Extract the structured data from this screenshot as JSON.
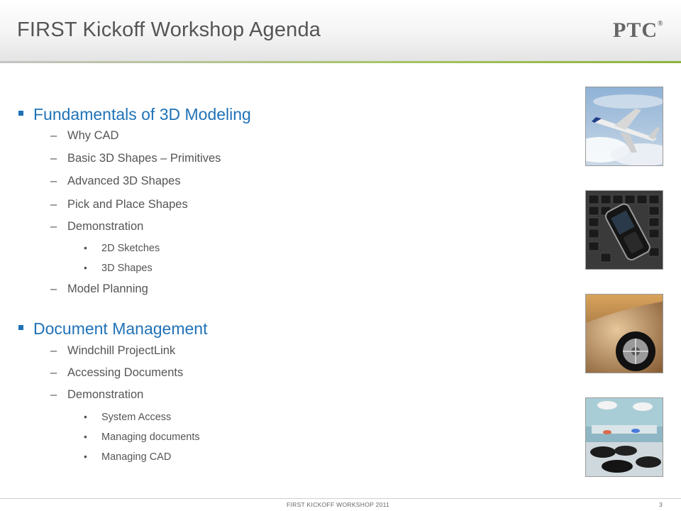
{
  "slide": {
    "title": "FIRST Kickoff Workshop Agenda",
    "logo": "PTC",
    "logo_mark": "®",
    "footer": "FIRST KICKOFF WORKSHOP 2011",
    "page_number": "3"
  },
  "sections": [
    {
      "heading": "Fundamentals of 3D Modeling",
      "items": [
        "Why CAD",
        "Basic 3D Shapes – Primitives",
        "Advanced 3D Shapes",
        "Pick and Place Shapes",
        "Demonstration"
      ],
      "demo_subitems": [
        "2D Sketches",
        "3D Shapes"
      ],
      "last_item": "Model Planning"
    },
    {
      "heading": "Document Management",
      "items": [
        "Windchill ProjectLink",
        "Accessing Documents",
        "Demonstration"
      ],
      "demo_subitems": [
        "System Access",
        "Managing documents",
        "Managing CAD"
      ]
    }
  ],
  "glyphs": {
    "dash": "–",
    "bullet": "•"
  },
  "colors": {
    "heading_blue": "#1f72b8",
    "body_gray": "#555555",
    "accent_green": "#8db43c"
  }
}
